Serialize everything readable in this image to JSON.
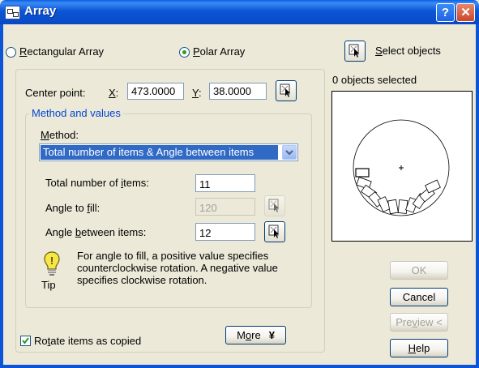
{
  "window": {
    "title": "Array",
    "help_symbol": "?",
    "close_symbol": "✕"
  },
  "mode": {
    "rectangular_label": "Rectangular Array",
    "rectangular_mnemonic": "R",
    "rectangular_rest": "ectangular Array",
    "polar_label": "Polar Array",
    "polar_mnemonic": "P",
    "polar_rest": "olar Array",
    "selected": "polar"
  },
  "select": {
    "label_mnemonic": "S",
    "label_rest": "elect objects",
    "status": "0 objects selected"
  },
  "center": {
    "label": "Center point:",
    "x_label_mnemonic": "X",
    "x_label_rest": ":",
    "x_value": "473.0000",
    "y_label_mnemonic": "Y",
    "y_label_rest": ":",
    "y_value": "38.0000"
  },
  "method_group": {
    "legend": "Method and values",
    "method_label_mnemonic": "M",
    "method_label_rest": "ethod:",
    "method_value": "Total number of items & Angle between items",
    "total_label_pre": "Total number of ",
    "total_label_mnemonic": "i",
    "total_label_post": "tems:",
    "total_value": "11",
    "fill_label_pre": "Angle to ",
    "fill_label_mnemonic": "f",
    "fill_label_post": "ill:",
    "fill_value": "120",
    "between_label_pre": "Angle ",
    "between_label_mnemonic": "b",
    "between_label_post": "etween items:",
    "between_value": "12"
  },
  "tip": {
    "line1": "For angle to fill, a positive value specifies",
    "line2": "counterclockwise rotation.  A negative value",
    "line3": "specifies clockwise rotation.",
    "label": "Tip"
  },
  "options": {
    "rotate_pre": "Ro",
    "rotate_mnemonic": "t",
    "rotate_post": "ate items as copied",
    "rotate_checked": true,
    "more_pre": "M",
    "more_mnemonic": "o",
    "more_post": "re",
    "more_arrow": "¥"
  },
  "buttons": {
    "ok": "OK",
    "cancel": "Cancel",
    "preview_pre": "Pre",
    "preview_mnemonic": "v",
    "preview_post": "iew <",
    "help_mnemonic": "H",
    "help_rest": "elp"
  },
  "icons": {
    "app": "array-icon",
    "pick": "pick-point-icon",
    "tip": "lightbulb-icon"
  }
}
